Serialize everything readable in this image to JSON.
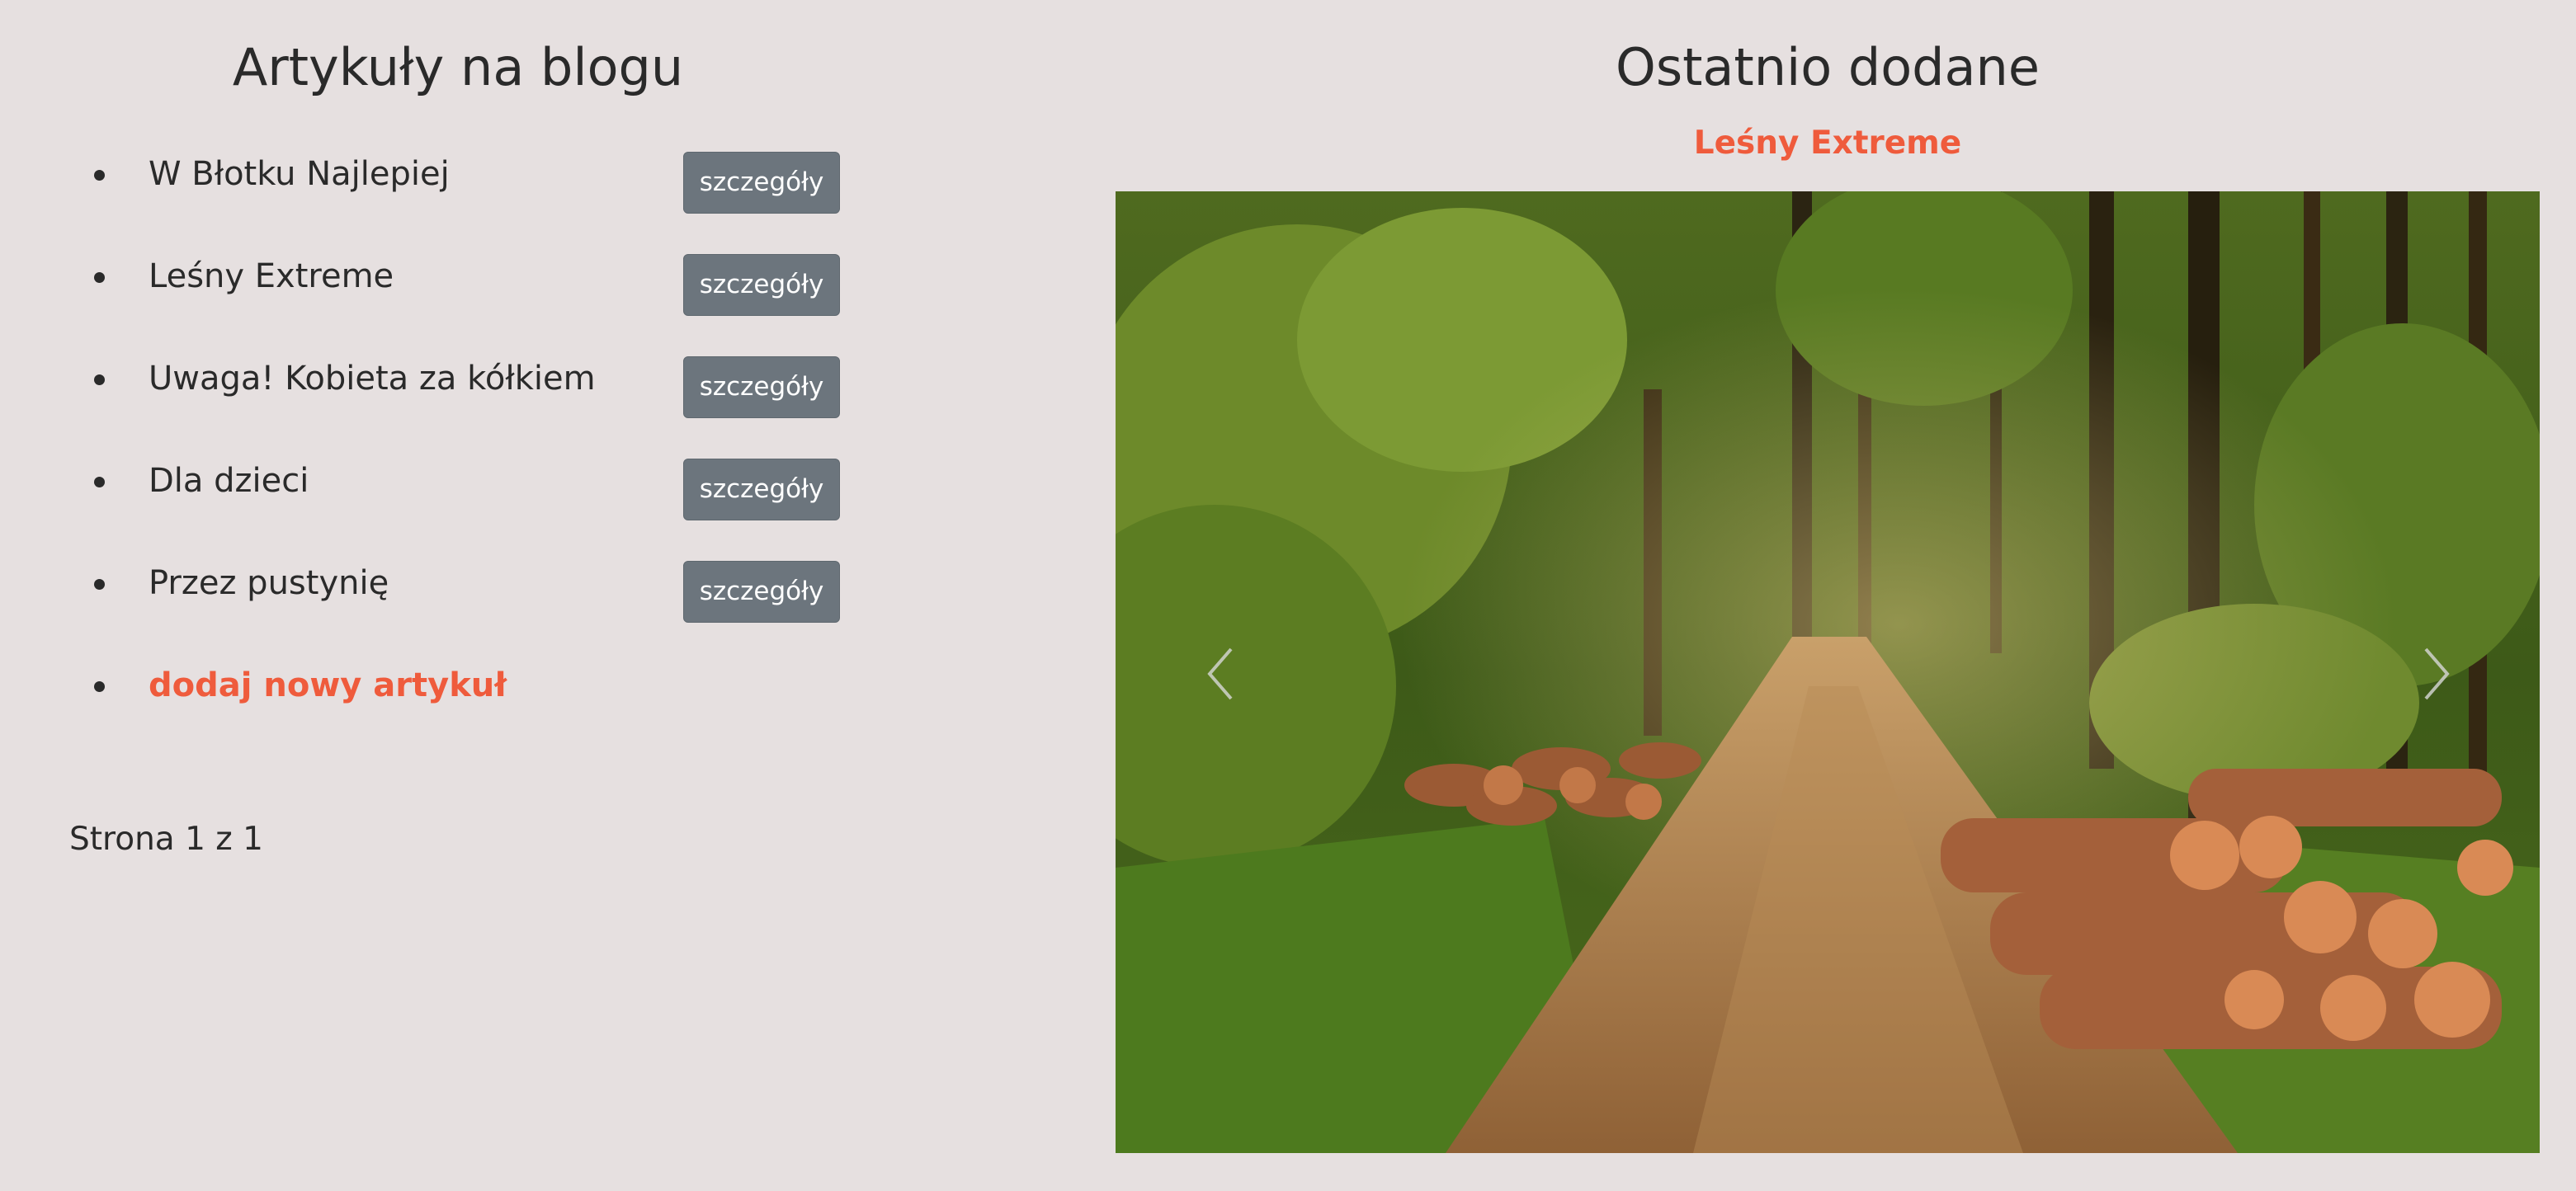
{
  "blog": {
    "heading": "Artykuły na blogu",
    "articles": [
      {
        "title": "W Błotku Najlepiej",
        "button_label": "szczegóły"
      },
      {
        "title": "Leśny Extreme",
        "button_label": "szczegóły"
      },
      {
        "title": "Uwaga! Kobieta za kółkiem",
        "button_label": "szczegóły"
      },
      {
        "title": "Dla dzieci",
        "button_label": "szczegóły"
      },
      {
        "title": "Przez pustynię",
        "button_label": "szczegóły"
      }
    ],
    "add_article_label": "dodaj nowy artykuł",
    "pagination_text": "Strona 1 z 1"
  },
  "recent": {
    "heading": "Ostatnio dodane",
    "featured_title": "Leśny Extreme",
    "image_description_icon": "forest-photo",
    "prev_icon": "chevron-left-icon",
    "next_icon": "chevron-right-icon"
  },
  "colors": {
    "background": "#e6e0e0",
    "accent": "#ef5b3c",
    "button": "#6c757d",
    "text": "#2a2a2a"
  }
}
